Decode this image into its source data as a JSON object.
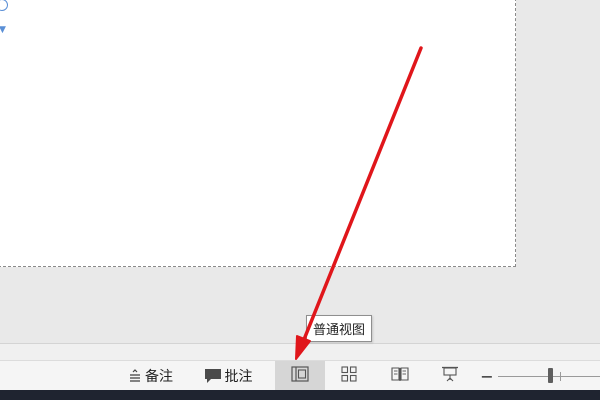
{
  "statusbar": {
    "notes_label": "备注",
    "comments_label": "批注",
    "zoom_minus": "−",
    "view_buttons": [
      {
        "name": "normal-view",
        "icon": "normal-view-icon",
        "active": true
      },
      {
        "name": "slide-sorter-view",
        "icon": "grid-icon",
        "active": false
      },
      {
        "name": "reading-view",
        "icon": "book-icon",
        "active": false
      },
      {
        "name": "slideshow-view",
        "icon": "projector-icon",
        "active": false
      }
    ]
  },
  "tooltip": {
    "text": "普通视图"
  },
  "colors": {
    "annotation_arrow": "#e0161b",
    "active_button_bg": "#d6d6d6",
    "taskbar": "#1f2430"
  }
}
